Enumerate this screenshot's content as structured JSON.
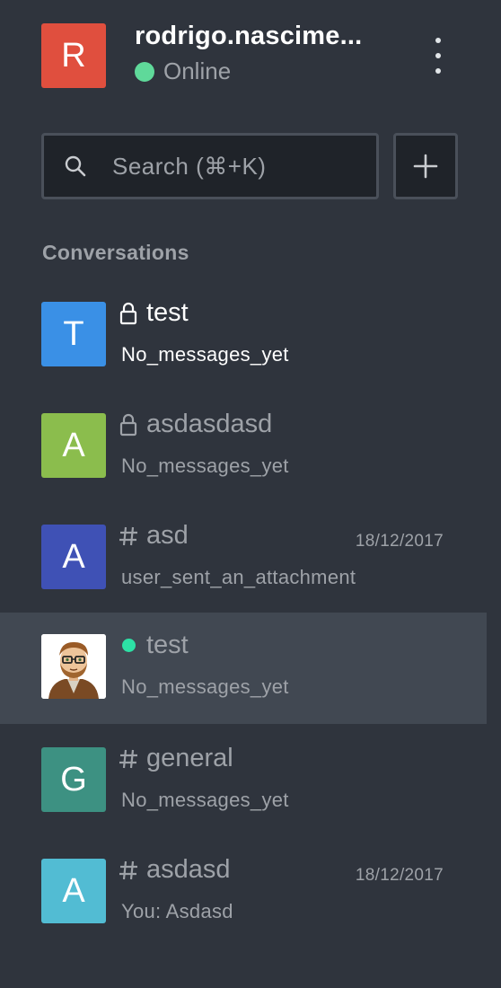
{
  "user": {
    "avatar_letter": "R",
    "avatar_color": "#e04f3e",
    "name": "rodrigo.nascime...",
    "status": "Online",
    "status_color": "#5fd99a"
  },
  "search": {
    "placeholder": "Search (⌘+K)"
  },
  "sections": {
    "conversations_title": "Conversations"
  },
  "conversations": [
    {
      "avatar_letter": "T",
      "avatar_color": "#3a90e6",
      "icon": "lock-icon",
      "name": "test",
      "subtitle": "No_messages_yet",
      "time": "",
      "unread": true
    },
    {
      "avatar_letter": "A",
      "avatar_color": "#8bbd4d",
      "icon": "lock-icon",
      "name": "asdasdasd",
      "subtitle": "No_messages_yet",
      "time": "",
      "unread": false
    },
    {
      "avatar_letter": "A",
      "avatar_color": "#3f51b5",
      "icon": "hash-icon",
      "name": "asd",
      "subtitle": "user_sent_an_attachment",
      "time": "18/12/2017",
      "unread": false
    },
    {
      "avatar_letter": "",
      "avatar_color": "#ffffff",
      "icon": "online-dot-icon",
      "name": "test",
      "subtitle": "No_messages_yet",
      "time": "",
      "unread": false,
      "active": true
    },
    {
      "avatar_letter": "G",
      "avatar_color": "#3d9182",
      "icon": "hash-icon",
      "name": "general",
      "subtitle": "No_messages_yet",
      "time": "",
      "unread": false
    },
    {
      "avatar_letter": "A",
      "avatar_color": "#52bcd3",
      "icon": "hash-icon",
      "name": "asdasd",
      "subtitle": "You: Asdasd",
      "time": "18/12/2017",
      "unread": false
    }
  ]
}
